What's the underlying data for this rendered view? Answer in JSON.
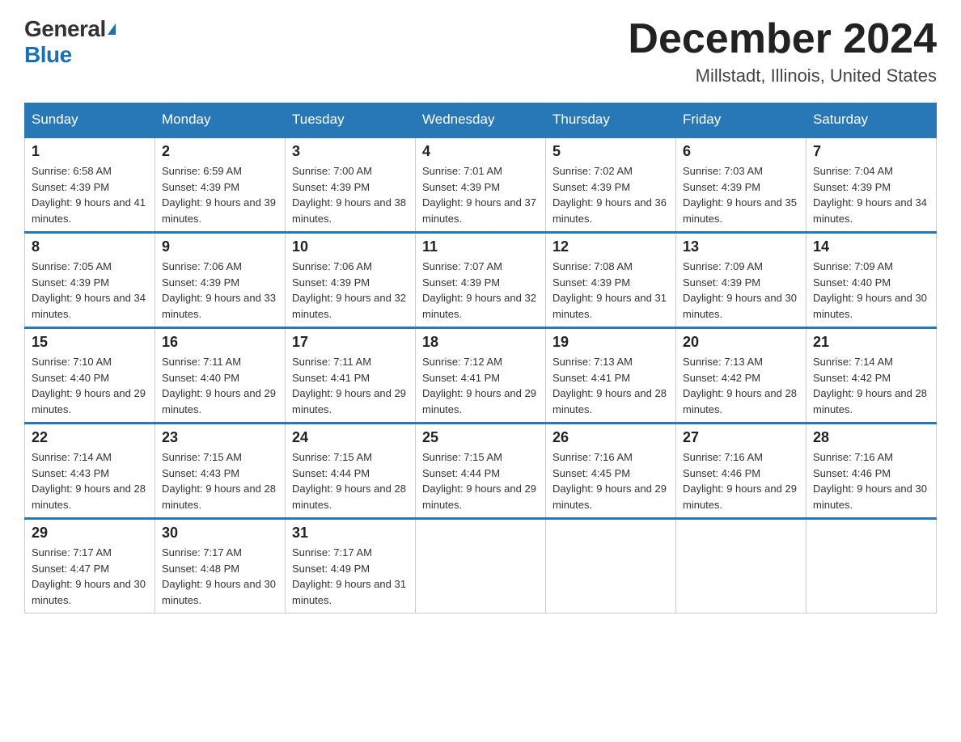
{
  "logo": {
    "general": "General",
    "blue": "Blue"
  },
  "title": {
    "month": "December 2024",
    "location": "Millstadt, Illinois, United States"
  },
  "weekdays": [
    "Sunday",
    "Monday",
    "Tuesday",
    "Wednesday",
    "Thursday",
    "Friday",
    "Saturday"
  ],
  "weeks": [
    [
      {
        "day": "1",
        "sunrise": "6:58 AM",
        "sunset": "4:39 PM",
        "daylight": "9 hours and 41 minutes."
      },
      {
        "day": "2",
        "sunrise": "6:59 AM",
        "sunset": "4:39 PM",
        "daylight": "9 hours and 39 minutes."
      },
      {
        "day": "3",
        "sunrise": "7:00 AM",
        "sunset": "4:39 PM",
        "daylight": "9 hours and 38 minutes."
      },
      {
        "day": "4",
        "sunrise": "7:01 AM",
        "sunset": "4:39 PM",
        "daylight": "9 hours and 37 minutes."
      },
      {
        "day": "5",
        "sunrise": "7:02 AM",
        "sunset": "4:39 PM",
        "daylight": "9 hours and 36 minutes."
      },
      {
        "day": "6",
        "sunrise": "7:03 AM",
        "sunset": "4:39 PM",
        "daylight": "9 hours and 35 minutes."
      },
      {
        "day": "7",
        "sunrise": "7:04 AM",
        "sunset": "4:39 PM",
        "daylight": "9 hours and 34 minutes."
      }
    ],
    [
      {
        "day": "8",
        "sunrise": "7:05 AM",
        "sunset": "4:39 PM",
        "daylight": "9 hours and 34 minutes."
      },
      {
        "day": "9",
        "sunrise": "7:06 AM",
        "sunset": "4:39 PM",
        "daylight": "9 hours and 33 minutes."
      },
      {
        "day": "10",
        "sunrise": "7:06 AM",
        "sunset": "4:39 PM",
        "daylight": "9 hours and 32 minutes."
      },
      {
        "day": "11",
        "sunrise": "7:07 AM",
        "sunset": "4:39 PM",
        "daylight": "9 hours and 32 minutes."
      },
      {
        "day": "12",
        "sunrise": "7:08 AM",
        "sunset": "4:39 PM",
        "daylight": "9 hours and 31 minutes."
      },
      {
        "day": "13",
        "sunrise": "7:09 AM",
        "sunset": "4:39 PM",
        "daylight": "9 hours and 30 minutes."
      },
      {
        "day": "14",
        "sunrise": "7:09 AM",
        "sunset": "4:40 PM",
        "daylight": "9 hours and 30 minutes."
      }
    ],
    [
      {
        "day": "15",
        "sunrise": "7:10 AM",
        "sunset": "4:40 PM",
        "daylight": "9 hours and 29 minutes."
      },
      {
        "day": "16",
        "sunrise": "7:11 AM",
        "sunset": "4:40 PM",
        "daylight": "9 hours and 29 minutes."
      },
      {
        "day": "17",
        "sunrise": "7:11 AM",
        "sunset": "4:41 PM",
        "daylight": "9 hours and 29 minutes."
      },
      {
        "day": "18",
        "sunrise": "7:12 AM",
        "sunset": "4:41 PM",
        "daylight": "9 hours and 29 minutes."
      },
      {
        "day": "19",
        "sunrise": "7:13 AM",
        "sunset": "4:41 PM",
        "daylight": "9 hours and 28 minutes."
      },
      {
        "day": "20",
        "sunrise": "7:13 AM",
        "sunset": "4:42 PM",
        "daylight": "9 hours and 28 minutes."
      },
      {
        "day": "21",
        "sunrise": "7:14 AM",
        "sunset": "4:42 PM",
        "daylight": "9 hours and 28 minutes."
      }
    ],
    [
      {
        "day": "22",
        "sunrise": "7:14 AM",
        "sunset": "4:43 PM",
        "daylight": "9 hours and 28 minutes."
      },
      {
        "day": "23",
        "sunrise": "7:15 AM",
        "sunset": "4:43 PM",
        "daylight": "9 hours and 28 minutes."
      },
      {
        "day": "24",
        "sunrise": "7:15 AM",
        "sunset": "4:44 PM",
        "daylight": "9 hours and 28 minutes."
      },
      {
        "day": "25",
        "sunrise": "7:15 AM",
        "sunset": "4:44 PM",
        "daylight": "9 hours and 29 minutes."
      },
      {
        "day": "26",
        "sunrise": "7:16 AM",
        "sunset": "4:45 PM",
        "daylight": "9 hours and 29 minutes."
      },
      {
        "day": "27",
        "sunrise": "7:16 AM",
        "sunset": "4:46 PM",
        "daylight": "9 hours and 29 minutes."
      },
      {
        "day": "28",
        "sunrise": "7:16 AM",
        "sunset": "4:46 PM",
        "daylight": "9 hours and 30 minutes."
      }
    ],
    [
      {
        "day": "29",
        "sunrise": "7:17 AM",
        "sunset": "4:47 PM",
        "daylight": "9 hours and 30 minutes."
      },
      {
        "day": "30",
        "sunrise": "7:17 AM",
        "sunset": "4:48 PM",
        "daylight": "9 hours and 30 minutes."
      },
      {
        "day": "31",
        "sunrise": "7:17 AM",
        "sunset": "4:49 PM",
        "daylight": "9 hours and 31 minutes."
      },
      null,
      null,
      null,
      null
    ]
  ]
}
